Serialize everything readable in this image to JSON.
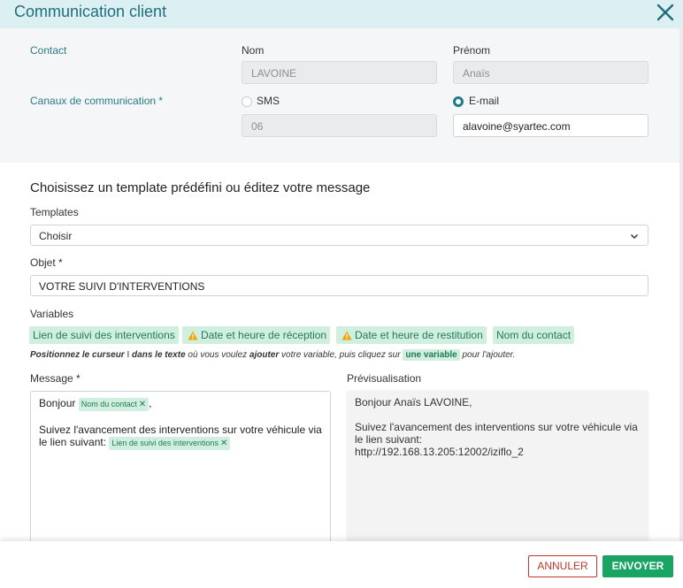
{
  "dialog": {
    "title": "Communication client"
  },
  "contact": {
    "label": "Contact",
    "nom_label": "Nom",
    "nom_value": "LAVOINE",
    "prenom_label": "Prénom",
    "prenom_value": "Anaïs"
  },
  "channels": {
    "label": "Canaux de communication *",
    "sms_label": "SMS",
    "sms_value": "06",
    "sms_checked": false,
    "email_label": "E-mail",
    "email_value": "alavoine@syartec.com",
    "email_checked": true
  },
  "template_section": {
    "title": "Choisissez un template prédéfini ou éditez votre message"
  },
  "templates": {
    "label": "Templates",
    "selected": "Choisir"
  },
  "objet": {
    "label": "Objet *",
    "value": "VOTRE SUIVI D'INTERVENTIONS"
  },
  "variables": {
    "label": "Variables",
    "chips": [
      {
        "label": "Lien de suivi des interventions",
        "warning": false
      },
      {
        "label": "Date et heure de réception",
        "warning": true
      },
      {
        "label": "Date et heure de restitution",
        "warning": true
      },
      {
        "label": "Nom du contact",
        "warning": false
      }
    ],
    "hint": {
      "p1": "Positionnez le curseur",
      "p2": "dans le texte",
      "p3": "où vous voulez",
      "p4": "ajouter",
      "p5": "votre variable, puis cliquez sur",
      "chip": "une variable",
      "p6": "pour l'ajouter."
    }
  },
  "message": {
    "label": "Message *",
    "greeting": "Bonjour",
    "tag_contact": "Nom du contact",
    "comma": ",",
    "line2": "Suivez l'avancement des interventions sur votre véhicule via le lien suivant:",
    "tag_link": "Lien de suivi des interventions"
  },
  "preview": {
    "label": "Prévisualisation",
    "line1": "Bonjour Anaïs LAVOINE,",
    "line2": "Suivez l'avancement des interventions sur votre véhicule via le lien suivant:",
    "line3": "http://192.168.13.205:12002/iziflo_2"
  },
  "buttons": {
    "cancel": "ANNULER",
    "send": "ENVOYER"
  },
  "colors": {
    "accent": "#1e7c88",
    "chip_bg": "#d1efdf",
    "send": "#19a463",
    "cancel": "#c0392b"
  }
}
